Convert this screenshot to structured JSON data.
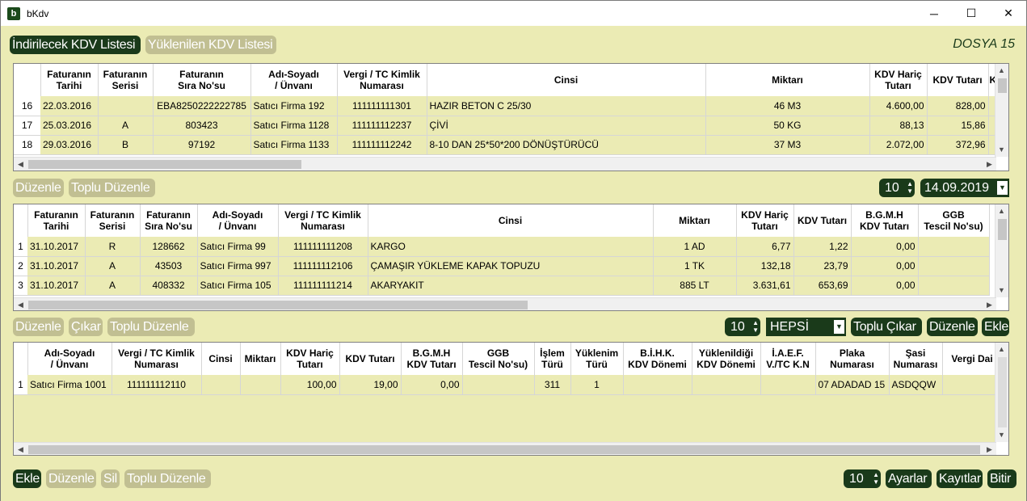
{
  "window": {
    "icon": "b",
    "title": "bKdv",
    "min": "─",
    "max": "☐",
    "close": "✕"
  },
  "top_tabs": {
    "active": "İndirilecek KDV Listesi",
    "inactive": "Yüklenilen KDV Listesi"
  },
  "dosya": "DOSYA 15",
  "grid1": {
    "headers": [
      "Faturanın\nTarihi",
      "Faturanın\nSerisi",
      "Faturanın\nSıra No'su",
      "Adı-Soyadı\n/ Ünvanı",
      "Vergi / TC Kimlik\nNumarası",
      "Cinsi",
      "Miktarı",
      "KDV Hariç\nTutarı",
      "KDV Tutarı",
      "K"
    ],
    "rows": [
      {
        "idx": "16",
        "cells": [
          "22.03.2016",
          "",
          "EBA8250222222785",
          "Satıcı Firma 192",
          "111111111301",
          "HAZIR BETON C 25/30",
          "46 M3",
          "4.600,00",
          "828,00",
          ""
        ]
      },
      {
        "idx": "17",
        "cells": [
          "25.03.2016",
          "A",
          "803423",
          "Satıcı Firma 1128",
          "111111112237",
          "ÇİVİ",
          "50 KG",
          "88,13",
          "15,86",
          ""
        ]
      },
      {
        "idx": "18",
        "cells": [
          "29.03.2016",
          "B",
          "97192",
          "Satıcı Firma 1133",
          "111111112242",
          "8-10 DAN 25*50*200 DÖNÜŞTÜRÜCÜ",
          "37 M3",
          "2.072,00",
          "372,96",
          ""
        ]
      }
    ]
  },
  "toolbar1": {
    "edit": "Düzenle",
    "bulk_edit": "Toplu Düzenle",
    "page_size": "10",
    "date": "14.09.2019"
  },
  "grid2": {
    "headers": [
      "Faturanın\nTarihi",
      "Faturanın\nSerisi",
      "Faturanın\nSıra No'su",
      "Adı-Soyadı\n/ Ünvanı",
      "Vergi / TC Kimlik\nNumarası",
      "Cinsi",
      "Miktarı",
      "KDV Hariç\nTutarı",
      "KDV Tutarı",
      "B.G.M.H\nKDV Tutarı",
      "GGB\nTescil No'su)"
    ],
    "rows": [
      {
        "idx": "1",
        "cells": [
          "31.10.2017",
          "R",
          "128662",
          "Satıcı Firma 99",
          "111111111208",
          "KARGO",
          "1 AD",
          "6,77",
          "1,22",
          "0,00",
          ""
        ]
      },
      {
        "idx": "2",
        "cells": [
          "31.10.2017",
          "A",
          "43503",
          "Satıcı Firma 997",
          "111111112106",
          "ÇAMAŞIR YÜKLEME KAPAK TOPUZU",
          "1 TK",
          "132,18",
          "23,79",
          "0,00",
          ""
        ]
      },
      {
        "idx": "3",
        "cells": [
          "31.10.2017",
          "A",
          "408332",
          "Satıcı Firma 105",
          "111111111214",
          "AKARYAKIT",
          "885 LT",
          "3.631,61",
          "653,69",
          "0,00",
          ""
        ]
      }
    ]
  },
  "toolbar2": {
    "edit": "Düzenle",
    "remove": "Çıkar",
    "bulk_edit": "Toplu Düzenle",
    "page_size": "10",
    "filter": "HEPSİ",
    "bulk_remove": "Toplu Çıkar",
    "edit2": "Düzenle",
    "add": "Ekle"
  },
  "grid3": {
    "headers": [
      "Adı-Soyadı\n/ Ünvanı",
      "Vergi / TC Kimlik\nNumarası",
      "Cinsi",
      "Miktarı",
      "KDV Hariç\nTutarı",
      "KDV Tutarı",
      "B.G.M.H\nKDV Tutarı",
      "GGB\nTescil No'su)",
      "İşlem\nTürü",
      "Yüklenim\nTürü",
      "B.İ.H.K.\nKDV Dönemi",
      "Yüklenildiği\nKDV Dönemi",
      "İ.A.E.F.\nV./TC K.N",
      "Plaka\nNumarası",
      "Şasi\nNumarası",
      "Vergi Dai"
    ],
    "rows": [
      {
        "idx": "1",
        "cells": [
          "Satıcı Firma 1001",
          "111111112110",
          "",
          "",
          "100,00",
          "19,00",
          "0,00",
          "",
          "311",
          "1",
          "",
          "",
          "",
          "07 ADADAD 15",
          "ASDQQW",
          ""
        ]
      }
    ]
  },
  "bottombar": {
    "add": "Ekle",
    "edit": "Düzenle",
    "delete": "Sil",
    "bulk_edit": "Toplu Düzenle",
    "page_size": "10",
    "settings": "Ayarlar",
    "records": "Kayıtlar",
    "finish": "Bitir"
  }
}
